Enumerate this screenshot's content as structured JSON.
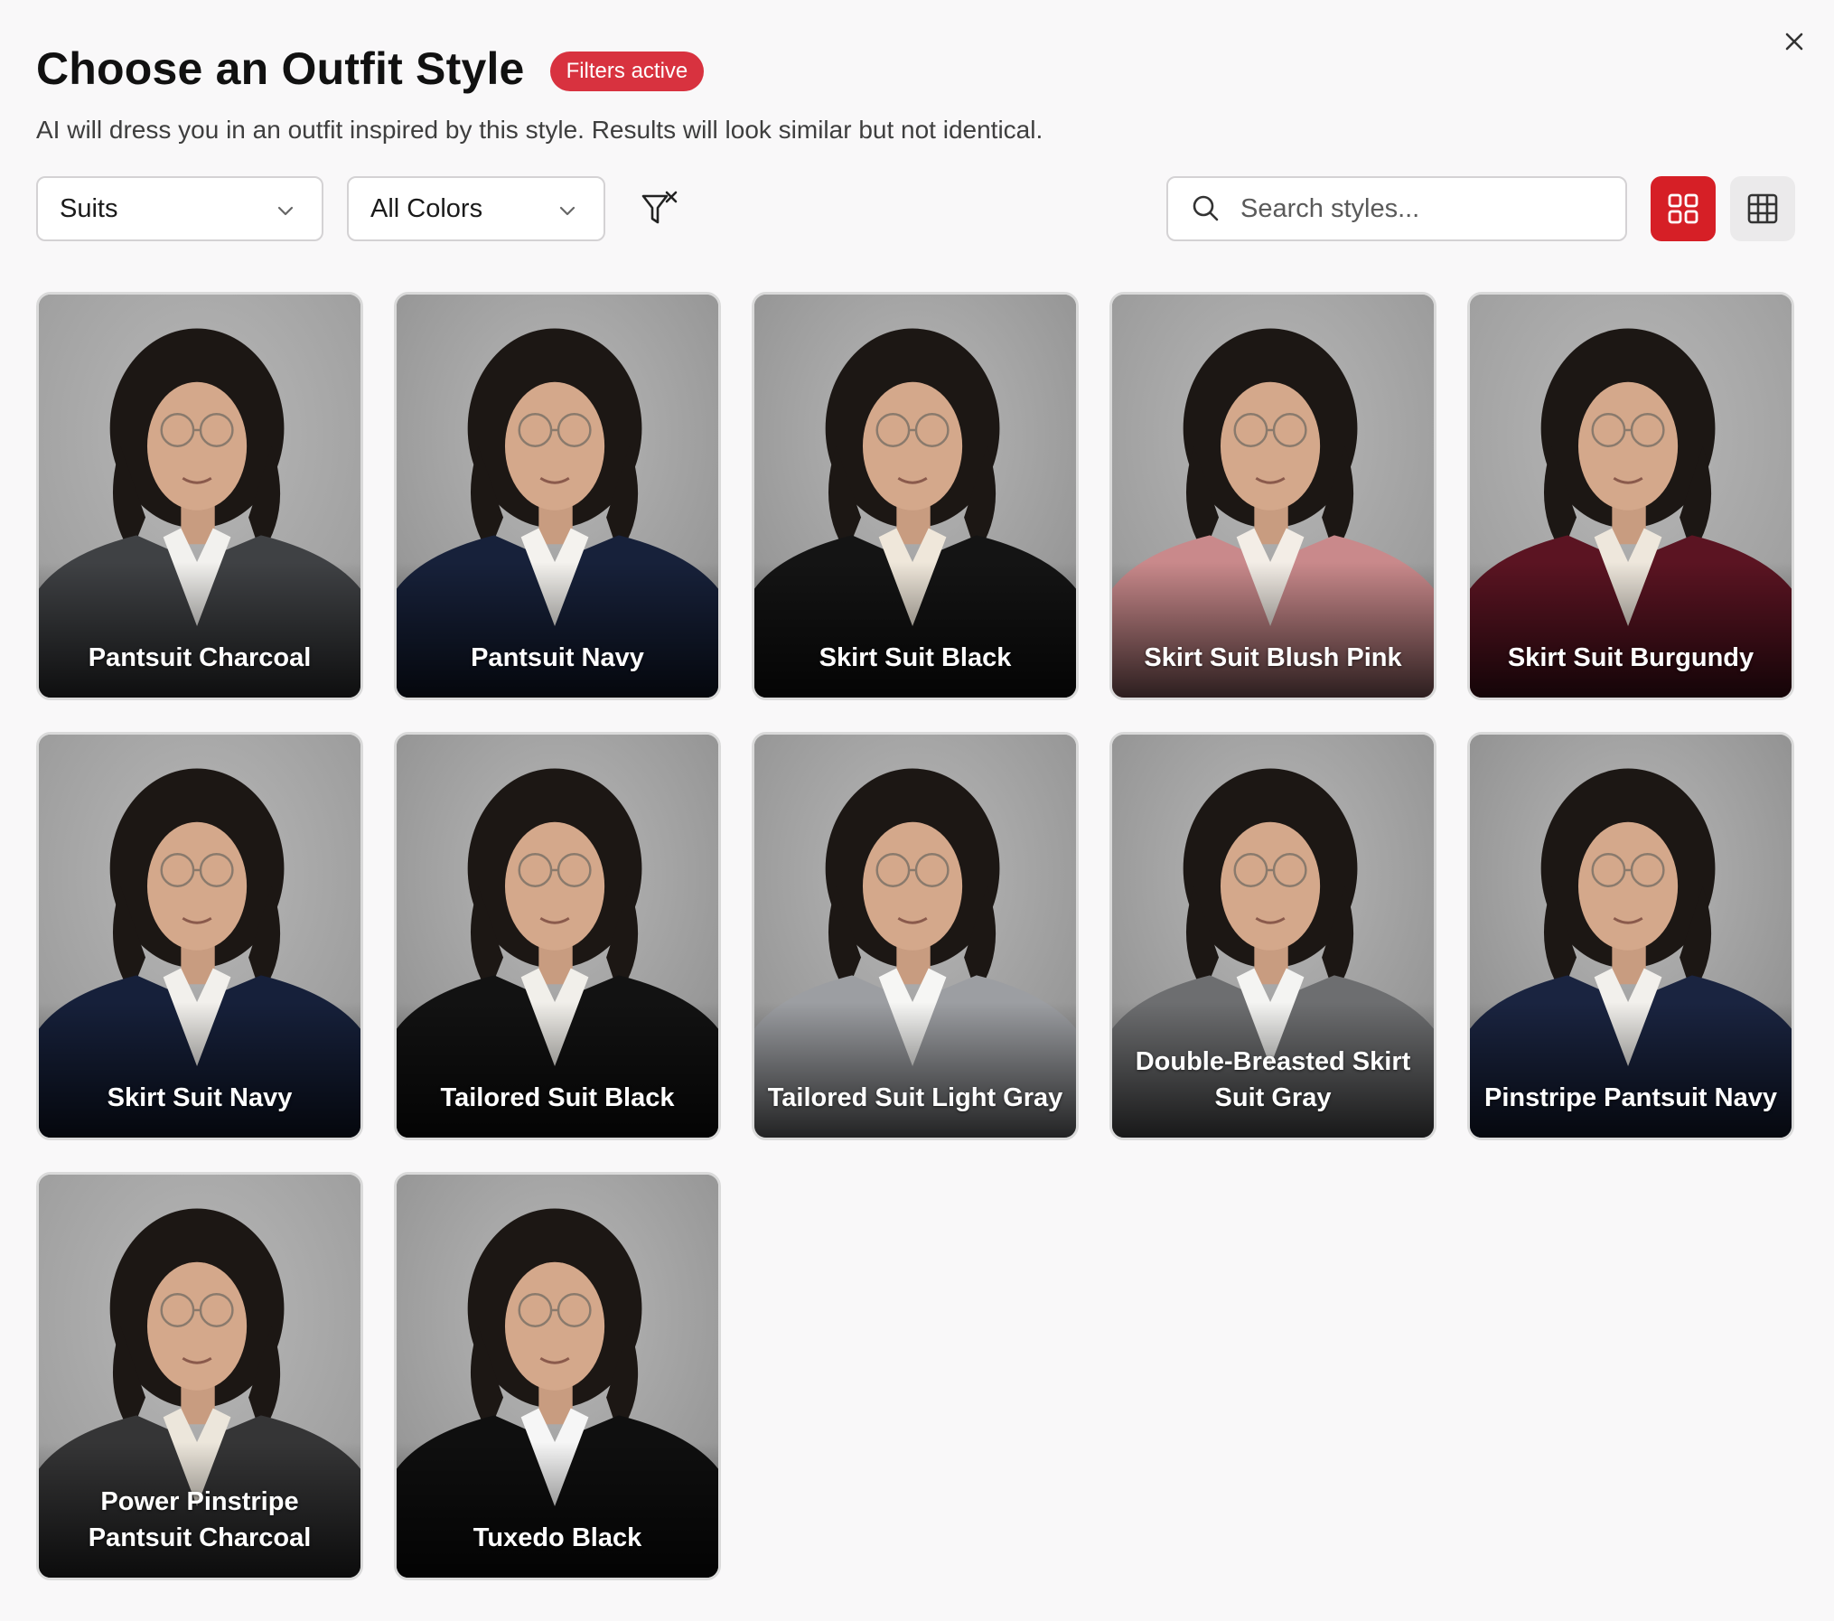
{
  "dialog": {
    "title": "Choose an Outfit Style",
    "badge": "Filters active",
    "subtitle": "AI will dress you in an outfit inspired by this style. Results will look similar but not identical."
  },
  "filters": {
    "category": "Suits",
    "color": "All Colors",
    "search_placeholder": "Search styles...",
    "search_value": ""
  },
  "view": {
    "selected": "large-grid"
  },
  "colors": {
    "accent": "#d61f26",
    "badge": "#d8323f",
    "background": "#f9f8f9"
  },
  "styles": [
    {
      "label": "Pantsuit Charcoal",
      "suit": "#3f4144",
      "shirt": "#f2f1ee",
      "bg": "#9a9a9a"
    },
    {
      "label": "Pantsuit Navy",
      "suit": "#17213a",
      "shirt": "#f4f2ee",
      "bg": "#8f8f8f"
    },
    {
      "label": "Skirt Suit Black",
      "suit": "#141414",
      "shirt": "#efe7da",
      "bg": "#8e8e8e"
    },
    {
      "label": "Skirt Suit Blush Pink",
      "suit": "#c9898b",
      "shirt": "#f3ede6",
      "bg": "#959595"
    },
    {
      "label": "Skirt Suit Burgundy",
      "suit": "#5b1422",
      "shirt": "#eee7dc",
      "bg": "#9a9a9a"
    },
    {
      "label": "Skirt Suit Navy",
      "suit": "#16203a",
      "shirt": "#f2f0ec",
      "bg": "#969696"
    },
    {
      "label": "Tailored Suit Black",
      "suit": "#121212",
      "shirt": "#f1efea",
      "bg": "#8d8d8d"
    },
    {
      "label": "Tailored Suit Light Gray",
      "suit": "#9c9ea2",
      "shirt": "#f6f6f4",
      "bg": "#8f8f8f"
    },
    {
      "label": "Double-Breasted Skirt Suit Gray",
      "suit": "#6d6e70",
      "shirt": "#f4f4f2",
      "bg": "#8d8d8d"
    },
    {
      "label": "Pinstripe Pantsuit Navy",
      "suit": "#1a2440",
      "shirt": "#f2f0ec",
      "bg": "#8a8a8a"
    },
    {
      "label": "Power Pinstripe Pantsuit Charcoal",
      "suit": "#353536",
      "shirt": "#ece6db",
      "bg": "#999999"
    },
    {
      "label": "Tuxedo Black",
      "suit": "#0f0f0f",
      "shirt": "#f6f6f6",
      "bg": "#8f8f8f"
    }
  ]
}
